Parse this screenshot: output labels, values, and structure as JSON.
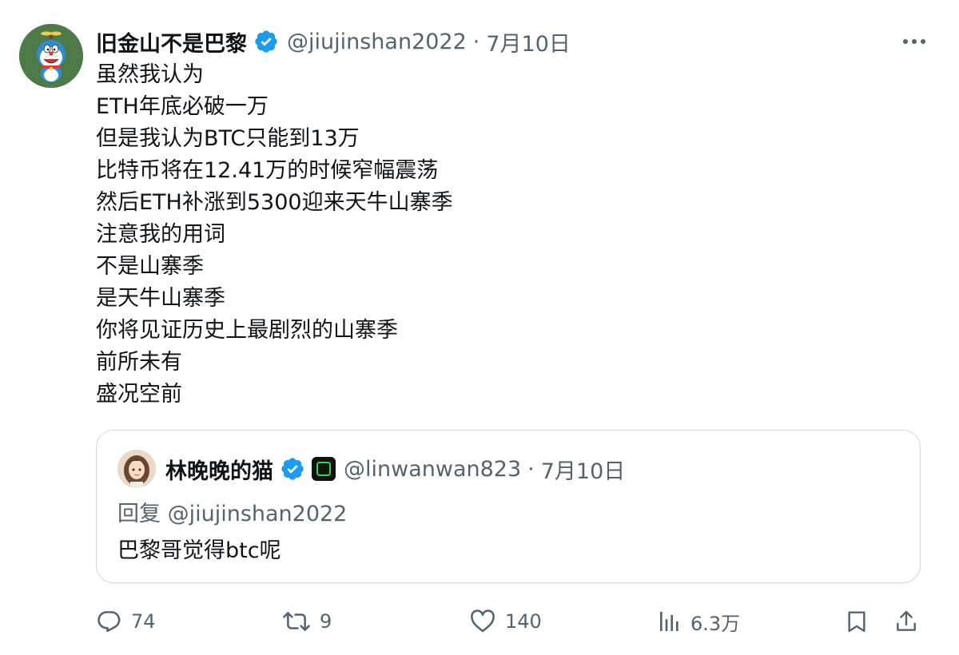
{
  "tweet": {
    "author": {
      "display_name": "旧金山不是巴黎",
      "handle": "@jiujinshan2022",
      "avatar_icon": "doraemon-avatar",
      "verified": true
    },
    "dot": "·",
    "date": "7月10日",
    "lines": [
      "虽然我认为",
      "ETH年底必破一万",
      "但是我认为BTC只能到13万",
      "比特币将在12.41万的时候窄幅震荡",
      "然后ETH补涨到5300迎来天牛山寨季",
      "注意我的用词",
      "不是山寨季",
      "是天牛山寨季",
      "你将见证历史上最剧烈的山寨季",
      "前所未有",
      "盛况空前"
    ]
  },
  "quote": {
    "author": {
      "display_name": "林晚晚的猫",
      "handle": "@linwanwan823",
      "verified": true,
      "affiliate_badge": "four-badge-icon"
    },
    "dot": "·",
    "date": "7月10日",
    "reply_to": "回复 @jiujinshan2022",
    "text": "巴黎哥觉得btc呢"
  },
  "actions": {
    "replies": "74",
    "retweets": "9",
    "likes": "140",
    "views": "6.3万"
  },
  "colors": {
    "text": "#0f1419",
    "secondary": "#536471",
    "verified_blue": "#1d9bf0",
    "border": "#cfd9de"
  }
}
